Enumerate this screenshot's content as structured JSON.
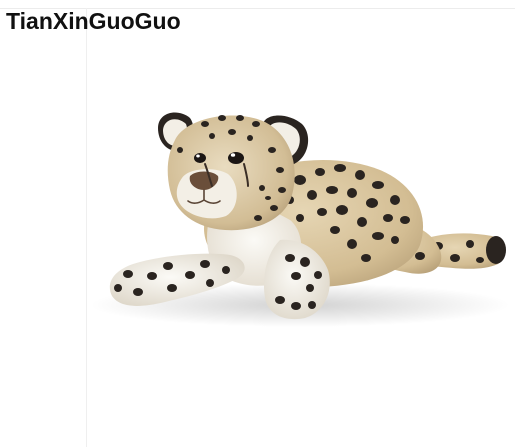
{
  "watermark": {
    "text": "TianXinGuoGuo"
  },
  "photo": {
    "subject": "leopard-plush-toy",
    "colors": {
      "background": "#ffffff",
      "fur_base": "#d9c6a0",
      "fur_light": "#f3efe6",
      "spot": "#2a2420",
      "nose": "#6a4e3a"
    }
  }
}
